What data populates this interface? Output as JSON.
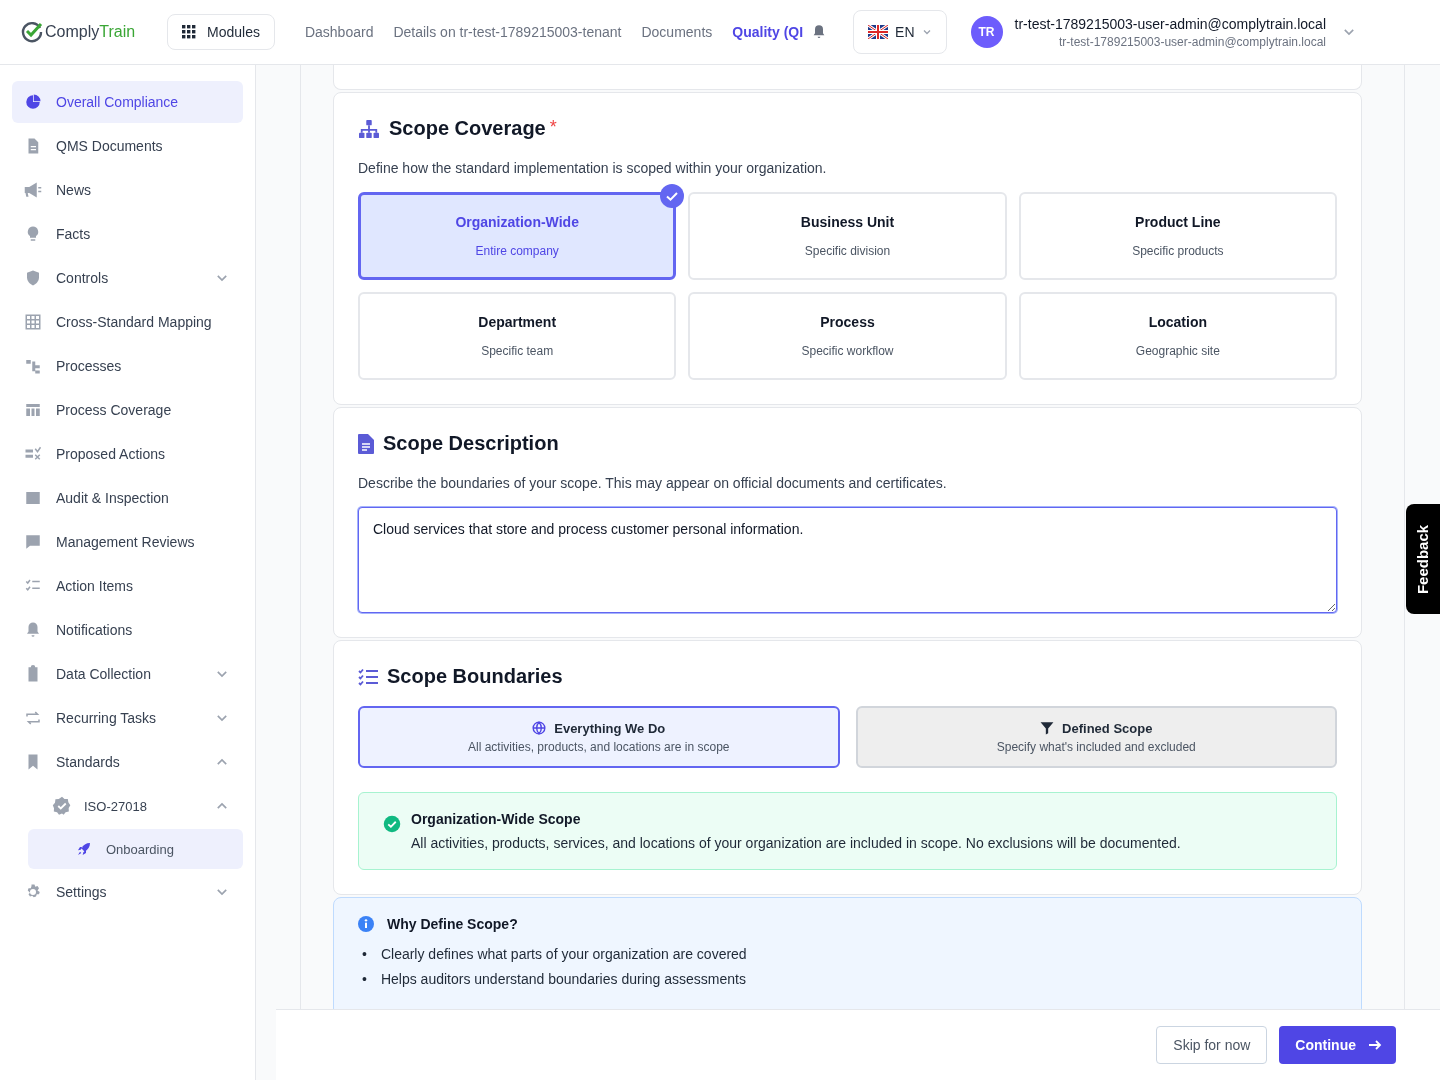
{
  "header": {
    "brand": {
      "first": "Comply",
      "second": "Train"
    },
    "modules_button": "Modules",
    "nav": [
      {
        "label": "Dashboard",
        "selected": false
      },
      {
        "label": "Details on tr-test-1789215003-tenant",
        "selected": false
      },
      {
        "label": "Documents",
        "selected": false
      },
      {
        "label": "Quality (QI",
        "selected": true
      }
    ],
    "language": "EN",
    "user": {
      "initials": "TR",
      "name": "tr-test-1789215003-user-admin@complytrain.local",
      "email": "tr-test-1789215003-user-admin@complytrain.local"
    }
  },
  "sidebar": {
    "items": [
      {
        "label": "Overall Compliance",
        "selected": true
      },
      {
        "label": "QMS Documents",
        "selected": false
      },
      {
        "label": "News",
        "selected": false
      },
      {
        "label": "Facts",
        "selected": false
      },
      {
        "label": "Controls",
        "selected": false,
        "expanded": false
      },
      {
        "label": "Cross-Standard Mapping",
        "selected": false
      },
      {
        "label": "Processes",
        "selected": false
      },
      {
        "label": "Process Coverage",
        "selected": false
      },
      {
        "label": "Proposed Actions",
        "selected": false
      },
      {
        "label": "Audit & Inspection",
        "selected": false
      },
      {
        "label": "Management Reviews",
        "selected": false
      },
      {
        "label": "Action Items",
        "selected": false
      },
      {
        "label": "Notifications",
        "selected": false
      },
      {
        "label": "Data Collection",
        "selected": false,
        "expanded": false
      },
      {
        "label": "Recurring Tasks",
        "selected": false,
        "expanded": false
      },
      {
        "label": "Standards",
        "selected": false,
        "expanded": true,
        "children": [
          {
            "label": "ISO-27018",
            "selected": false,
            "expanded": true,
            "children": [
              {
                "label": "Onboarding",
                "selected": true
              }
            ]
          }
        ]
      },
      {
        "label": "Settings",
        "selected": false,
        "expanded": false
      }
    ]
  },
  "scope_coverage": {
    "title": "Scope Coverage",
    "required_mark": "*",
    "description": "Define how the standard implementation is scoped within your organization.",
    "options": [
      {
        "title": "Organization-Wide",
        "subtitle": "Entire company",
        "selected": true
      },
      {
        "title": "Business Unit",
        "subtitle": "Specific division",
        "selected": false
      },
      {
        "title": "Product Line",
        "subtitle": "Specific products",
        "selected": false
      },
      {
        "title": "Department",
        "subtitle": "Specific team",
        "selected": false
      },
      {
        "title": "Process",
        "subtitle": "Specific workflow",
        "selected": false
      },
      {
        "title": "Location",
        "subtitle": "Geographic site",
        "selected": false
      }
    ]
  },
  "scope_description": {
    "title": "Scope Description",
    "description": "Describe the boundaries of your scope. This may appear on official documents and certificates.",
    "value": "Cloud services that store and process customer personal information."
  },
  "scope_boundaries": {
    "title": "Scope Boundaries",
    "options": [
      {
        "kind": "globe",
        "title": "Everything We Do",
        "subtitle": "All activities, products, and locations are in scope",
        "selected": true
      },
      {
        "kind": "filter",
        "title": "Defined Scope",
        "subtitle": "Specify what's included and excluded",
        "selected": false
      }
    ],
    "notice": {
      "title": "Organization-Wide Scope",
      "text": "All activities, products, services, and locations of your organization are included in scope. No exclusions will be documented."
    }
  },
  "info": {
    "title": "Why Define Scope?",
    "bullets": [
      {
        "marker": "•",
        "text": "Clearly defines what parts of your organization are covered"
      },
      {
        "marker": "•",
        "text": "Helps auditors understand boundaries during assessments"
      }
    ]
  },
  "footer": {
    "skip": "Skip for now",
    "continue": "Continue"
  },
  "feedback": "Feedback"
}
